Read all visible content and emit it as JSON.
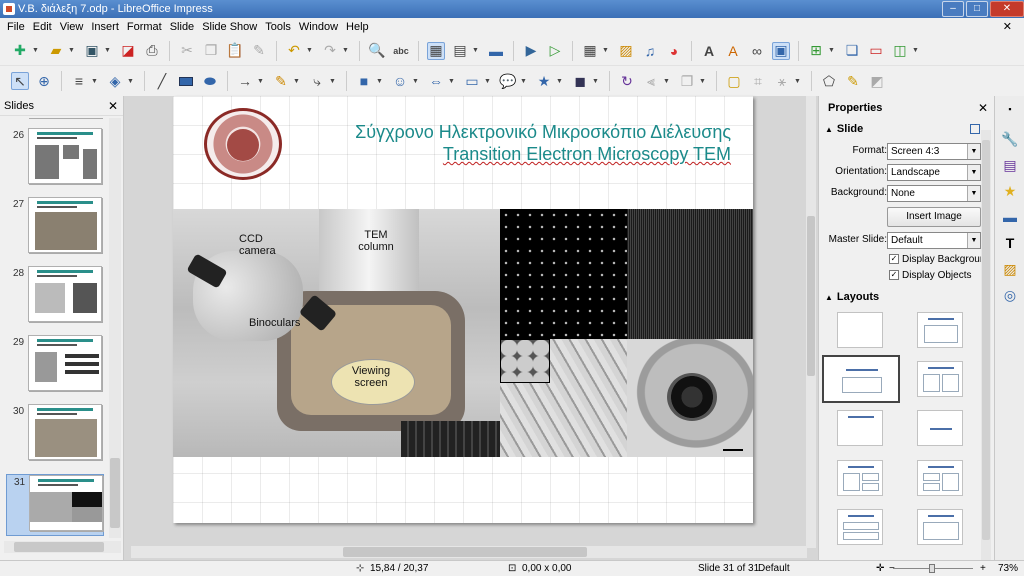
{
  "window": {
    "title": "V.B. διάλεξη 7.odp - LibreOffice Impress"
  },
  "menu": [
    "File",
    "Edit",
    "View",
    "Insert",
    "Format",
    "Slide",
    "Slide Show",
    "Tools",
    "Window",
    "Help"
  ],
  "slides_panel": {
    "title": "Slides",
    "thumbnails": [
      {
        "number": "26"
      },
      {
        "number": "27"
      },
      {
        "number": "28"
      },
      {
        "number": "29"
      },
      {
        "number": "30"
      },
      {
        "number": "31",
        "active": true
      }
    ]
  },
  "slide": {
    "title_greek": "Σύγχρονο Ηλεκτρονικό Μικροσκόπιο Διέλευσης",
    "title_english": "Transition Electron Microscopy TEM",
    "photo_labels": {
      "ccd": "CCD camera",
      "tem": "TEM column",
      "binoculars": "Binoculars",
      "viewing": "Viewing screen"
    }
  },
  "properties": {
    "title": "Properties",
    "slide_section": "Slide",
    "format_label": "Format:",
    "format_value": "Screen 4:3",
    "orientation_label": "Orientation:",
    "orientation_value": "Landscape",
    "background_label": "Background:",
    "background_value": "None",
    "insert_image": "Insert Image",
    "master_label": "Master Slide:",
    "master_value": "Default",
    "display_background": "Display Background",
    "display_objects": "Display Objects",
    "layouts_section": "Layouts"
  },
  "status": {
    "position": "15,84 / 20,37",
    "size": "0,00 x 0,00",
    "slide": "Slide 31 of 31",
    "master": "Default",
    "zoom": "73%"
  },
  "colors": {
    "title": "#1b8a8a",
    "titlebar": "#3b6fb6"
  }
}
